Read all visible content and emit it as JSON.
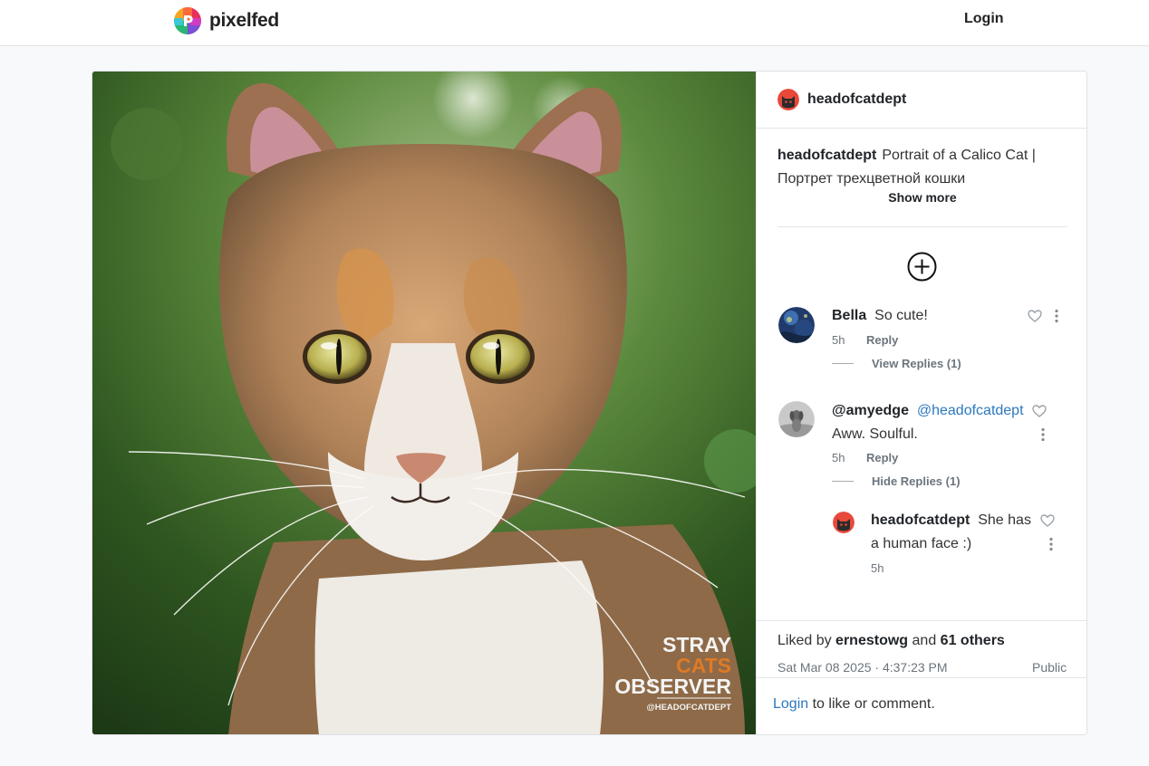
{
  "header": {
    "brand": "pixelfed",
    "login_label": "Login"
  },
  "post": {
    "author": "headofcatdept",
    "caption_user": "headofcatdept",
    "caption_text": "Portrait of a Calico Cat | Портрет трехцветной кошки",
    "show_more": "Show more",
    "watermark": {
      "line1": "STRAY",
      "line2": "CATS",
      "line3": "OBSERVER",
      "handle": "@HEADOFCATDEPT"
    },
    "comments": [
      {
        "user": "Bella",
        "text": "So cute!",
        "time": "5h",
        "reply_label": "Reply",
        "toggle_label": "View Replies (1)"
      },
      {
        "user": "@amyedge",
        "mention": "@headofcatdept",
        "text": "Aww. Soulful.",
        "time": "5h",
        "reply_label": "Reply",
        "toggle_label": "Hide Replies (1)",
        "replies": [
          {
            "user": "headofcatdept",
            "text_line1": "She has",
            "text_line2": "a human face :)",
            "time": "5h"
          }
        ]
      }
    ],
    "likes_prefix": "Liked by",
    "liked_by": "ernestowg",
    "likes_and": "and",
    "likes_others": "61 others",
    "date": "Sat Mar 08 2025 · 4:37:23 PM",
    "visibility": "Public",
    "login_prompt_link": "Login",
    "login_prompt_text": "to like or comment."
  },
  "colors": {
    "link": "#2c78bf",
    "watermark_orange": "#e07a25",
    "avatar_red": "#e8493a"
  },
  "icons": [
    "pixelfed-logo-icon",
    "cat-avatar-icon",
    "add-circle-icon",
    "heart-icon",
    "more-vertical-icon"
  ]
}
